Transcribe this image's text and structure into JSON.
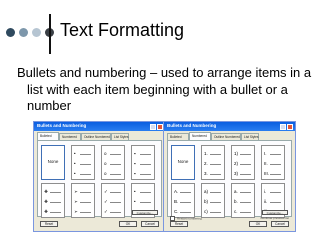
{
  "slide": {
    "title": "Text Formatting",
    "body": "Bullets and numbering – used to arrange items in a list with each item beginning with a bullet or a number"
  },
  "dialog_left": {
    "title": "Bullets and Numbering",
    "tabs": [
      "Bulleted",
      "Numbered",
      "Outline Numbered",
      "List Styles"
    ],
    "active_tab": 0,
    "none_label": "None",
    "cells": [
      {
        "marks": []
      },
      {
        "marks": [
          "•",
          "•",
          "•"
        ]
      },
      {
        "marks": [
          "o",
          "o",
          "o"
        ]
      },
      {
        "marks": [
          "▪",
          "▪",
          "▪"
        ]
      },
      {
        "marks": [
          "❖",
          "❖",
          "❖"
        ]
      },
      {
        "marks": [
          "➢",
          "➢",
          "➢"
        ]
      },
      {
        "marks": [
          "✓",
          "✓",
          "✓"
        ]
      },
      {
        "marks": [
          "•",
          "•",
          "•"
        ]
      }
    ],
    "buttons": {
      "customize": "Customize...",
      "reset": "Reset",
      "ok": "OK",
      "cancel": "Cancel"
    }
  },
  "dialog_right": {
    "title": "Bullets and Numbering",
    "tabs": [
      "Bulleted",
      "Numbered",
      "Outline Numbered",
      "List Styles"
    ],
    "active_tab": 1,
    "none_label": "None",
    "cells": [
      {
        "marks": []
      },
      {
        "marks": [
          "1.",
          "2.",
          "3."
        ]
      },
      {
        "marks": [
          "1)",
          "2)",
          "3)"
        ]
      },
      {
        "marks": [
          "I.",
          "II.",
          "III."
        ]
      },
      {
        "marks": [
          "A.",
          "B.",
          "C."
        ]
      },
      {
        "marks": [
          "a)",
          "b)",
          "c)"
        ]
      },
      {
        "marks": [
          "a.",
          "b.",
          "c."
        ]
      },
      {
        "marks": [
          "i.",
          "ii.",
          "iii."
        ]
      }
    ],
    "restart_label": "Restart numbering",
    "continue_label": "Continue previous list",
    "buttons": {
      "customize": "Customize...",
      "reset": "Reset",
      "ok": "OK",
      "cancel": "Cancel"
    }
  },
  "colors": {
    "titlebar": "#0a5ee0",
    "dialog_bg": "#ece9d8",
    "dot_dark": "#2f4a5f",
    "dot_mid": "#7d97ab",
    "dot_light": "#b6c5d2"
  }
}
